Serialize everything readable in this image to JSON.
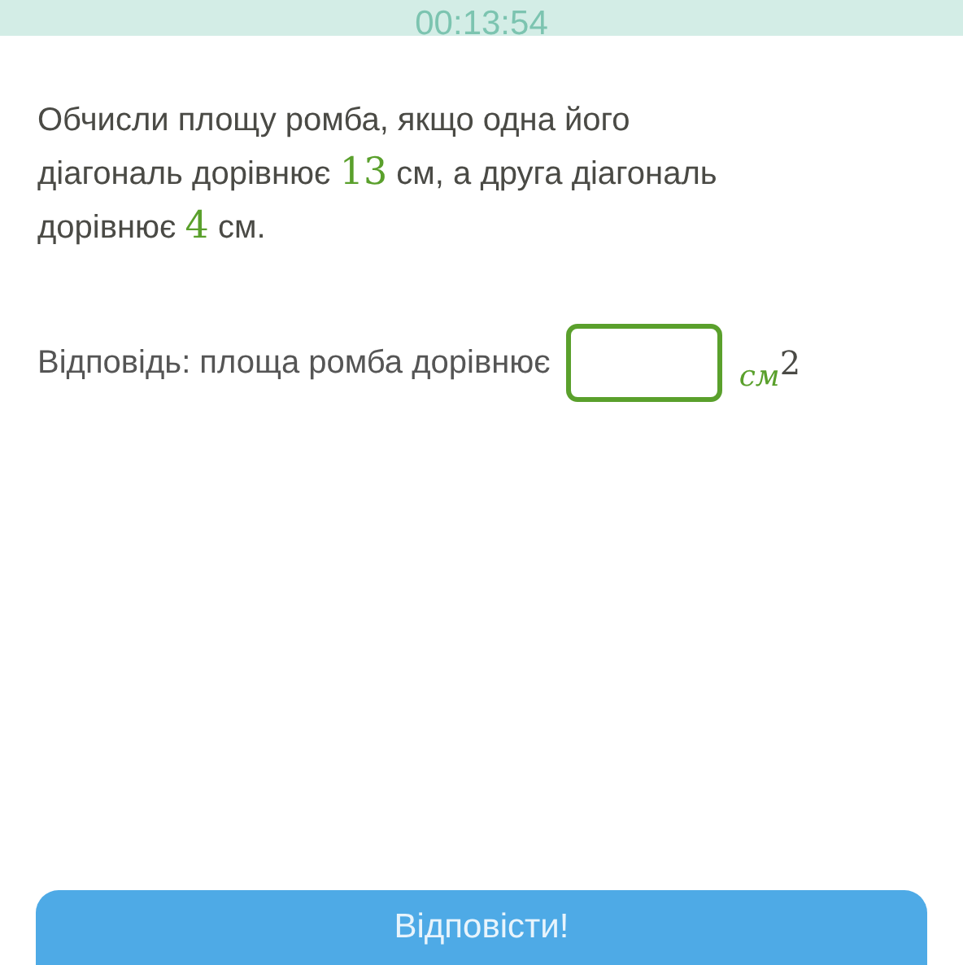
{
  "timer": "00:13:54",
  "question": [
    {
      "kind": "text",
      "text": "Обчисли площу ромба, якщо одна його діагональ дорівнює "
    },
    {
      "kind": "number",
      "text": "13"
    },
    {
      "kind": "text",
      "text": " см, а друга діагональ дорівнює "
    },
    {
      "kind": "number",
      "text": "4"
    },
    {
      "kind": "text",
      "text": " см."
    }
  ],
  "answer": {
    "label": "Відповідь: площа ромба дорівнює",
    "unit": "см$^{2}$"
  },
  "submit_button": "Відповісти!"
}
